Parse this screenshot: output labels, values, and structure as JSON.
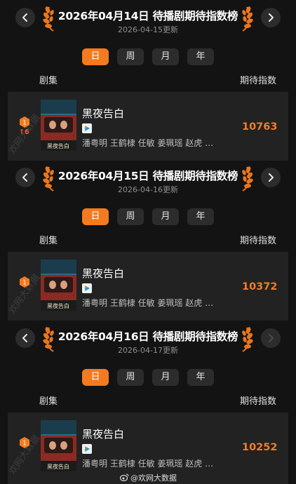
{
  "common": {
    "tabs": [
      "日",
      "周",
      "月",
      "年"
    ],
    "col_name": "剧集",
    "col_index": "期待指数",
    "drama_name": "黑夜告白",
    "cast": "潘粤明 王鹤棣 任敏 姜珮瑶 赵虎 …",
    "poster_text": "黑夜告白",
    "watermark": "欢网大数据",
    "rank": "1"
  },
  "sections": [
    {
      "title": "2026年04月14日 待播剧期待指数榜",
      "updated": "2026-04-15更新",
      "score": "10763",
      "rank_change": "↑6"
    },
    {
      "title": "2026年04月15日 待播剧期待指数榜",
      "updated": "2026-04-16更新",
      "score": "10372",
      "rank_change": ""
    },
    {
      "title": "2026年04月16日 待播剧期待指数榜",
      "updated": "2026-04-17更新",
      "score": "10252",
      "rank_change": ""
    }
  ],
  "footer": {
    "weibo_handle": "@欢网大数据"
  },
  "colors": {
    "accent": "#f47a1f",
    "score": "#f07d2a",
    "rank_up": "#f05a28",
    "background": "#131313",
    "row": "#222222"
  },
  "icons": [
    "chevron-left-icon",
    "chevron-right-icon",
    "laurel-wreath-icon",
    "rank-medal-icon",
    "platform-icon",
    "weibo-icon"
  ]
}
